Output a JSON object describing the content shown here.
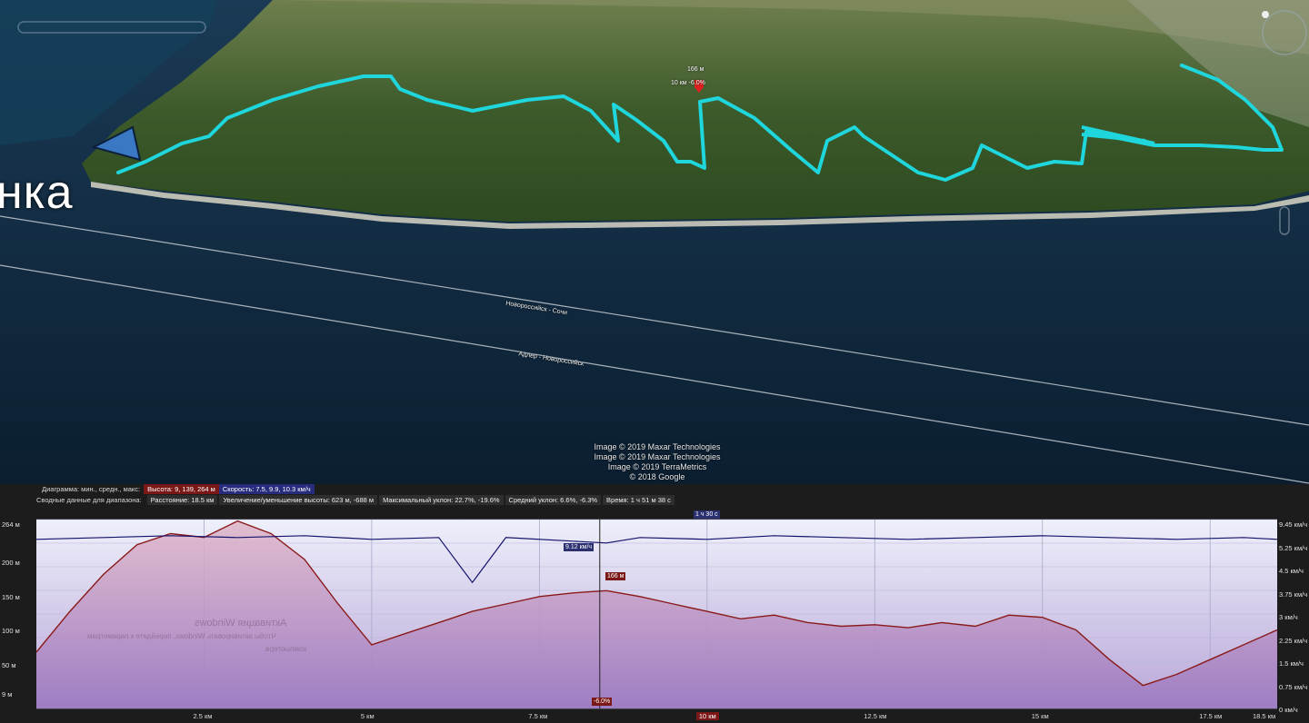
{
  "map": {
    "place_fragment": "нка",
    "credits": [
      "Image © 2019 Maxar Technologies",
      "Image © 2019 Maxar Technologies",
      "Image © 2019 TerraMetrics",
      "© 2018 Google"
    ],
    "route_labels": [
      "Новороссийск - Сочи",
      "Адлер - Новороссийск"
    ],
    "pin": {
      "elev": "166 м",
      "info": "10 км   -6.0%"
    },
    "colors": {
      "track": "#1fd6dc",
      "sea": "#0f2a40",
      "land": "#3f5a2c"
    }
  },
  "summary": {
    "row1_label": "Диаграмма: мин., средн., макс:",
    "height_tag": "Высота: 9, 139, 264 м",
    "speed_tag": "Скорость: 7.5, 9.9, 10.3 км/ч",
    "row2_label": "Сводные данные для диапазона:",
    "distance": "Расстояние: 18.5 км",
    "gain": "Увеличение/уменьшение высоты: 623 м, -688 м",
    "max_slope": "Максимальный уклон: 22.7%, -19.6%",
    "avg_slope": "Средний уклон: 6.6%, -6.3%",
    "time": "Время: 1 ч 51 м 38 с"
  },
  "chart": {
    "y_left": [
      "264 м",
      "200 м",
      "150 м",
      "100 м",
      "50 м",
      "9 м"
    ],
    "y_right": [
      "9.45 км/ч",
      "5.25 км/ч",
      "4.5 км/ч",
      "3.75 км/ч",
      "3 км/ч",
      "2.25 км/ч",
      "1.5 км/ч",
      "0.75 км/ч",
      "0 км/ч"
    ],
    "x_ticks": [
      "2.5 км",
      "5 км",
      "7.5 км",
      "10 км",
      "12.5 км",
      "15 км",
      "17.5 км",
      "18.5 км"
    ],
    "cursor_distance": "10 км",
    "cursor_time": "1 ч 30 с",
    "cursor_speed": "9.12 км/ч",
    "cursor_elev": "166 м",
    "cursor_slope": "-6.0%",
    "watermark1": "Активация Windows",
    "watermark2": "Чтобы активировать Windows, перейдите к параметрам",
    "watermark3": "компьютера."
  },
  "chart_data": {
    "type": "line",
    "xlabel": "",
    "ylabel": "",
    "x_unit": "км",
    "xlim": [
      0,
      18.5
    ],
    "ylim": [
      9,
      264
    ],
    "series": [
      {
        "x": [
          0,
          0.5,
          1,
          1.5,
          2,
          2.5,
          3,
          3.5,
          4,
          4.5,
          5,
          5.5,
          6,
          6.5,
          7,
          7.5,
          8,
          8.5,
          9,
          9.5,
          10,
          10.5,
          11,
          11.5,
          12,
          12.5,
          13,
          13.5,
          14,
          14.5,
          15,
          15.5,
          16,
          16.5,
          17,
          17.5,
          18,
          18.5
        ],
        "values": [
          85,
          140,
          190,
          230,
          245,
          240,
          262,
          245,
          210,
          150,
          95,
          110,
          125,
          140,
          150,
          160,
          165,
          168,
          160,
          150,
          140,
          130,
          135,
          125,
          120,
          122,
          118,
          125,
          120,
          135,
          132,
          115,
          75,
          40,
          55,
          75,
          95,
          115
        ]
      },
      {
        "x": [
          0,
          1,
          2,
          3,
          4,
          5,
          6,
          6.5,
          7,
          8,
          8.5,
          9,
          10,
          11,
          12,
          13,
          14,
          15,
          16,
          17,
          18,
          18.5
        ],
        "values": [
          9.4,
          9.5,
          9.6,
          9.5,
          9.6,
          9.4,
          9.5,
          7.0,
          9.5,
          9.3,
          9.2,
          9.5,
          9.4,
          9.6,
          9.5,
          9.4,
          9.5,
          9.6,
          9.5,
          9.4,
          9.5,
          9.4
        ]
      }
    ]
  }
}
